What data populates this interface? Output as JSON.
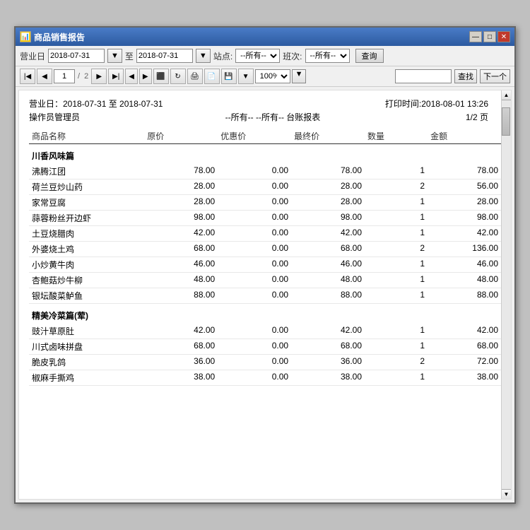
{
  "window": {
    "title": "商品销售报告",
    "title_icon": "📊"
  },
  "titleButtons": {
    "minimize": "—",
    "restore": "□",
    "close": "✕"
  },
  "toolbar": {
    "date_label": "营业日",
    "date_from": "2018-07-31",
    "date_to_sep": "至",
    "date_to": "2018-07-31",
    "station_label": "站点:",
    "station_value": "--所有--",
    "shift_label": "班次:",
    "shift_value": "--所有--",
    "query_btn": "查询"
  },
  "navBar": {
    "page_current": "1",
    "page_total": "2",
    "zoom_value": "100%",
    "find_btn": "查找",
    "next_btn": "下一个"
  },
  "report": {
    "date_range": "营业日：2018-07-31 至 2018-07-31",
    "print_time": "打印时间:2018-08-01 13:26",
    "operator": "操作员管理员",
    "center_info": "--所有--  --所有--  台账报表",
    "page_info": "1/2 页",
    "columns": {
      "name": "商品名称",
      "price": "原价",
      "discount": "优惠价",
      "final": "最终价",
      "qty": "数量",
      "amount": "金额"
    },
    "categories": [
      {
        "name": "川香风味篇",
        "items": [
          {
            "name": "沸腾江团",
            "price": "78.00",
            "discount": "0.00",
            "final": "78.00",
            "qty": "1",
            "amount": "78.00"
          },
          {
            "name": "荷兰豆炒山药",
            "price": "28.00",
            "discount": "0.00",
            "final": "28.00",
            "qty": "2",
            "amount": "56.00"
          },
          {
            "name": "家常豆腐",
            "price": "28.00",
            "discount": "0.00",
            "final": "28.00",
            "qty": "1",
            "amount": "28.00"
          },
          {
            "name": "蒜蓉粉丝开边虾",
            "price": "98.00",
            "discount": "0.00",
            "final": "98.00",
            "qty": "1",
            "amount": "98.00"
          },
          {
            "name": "土豆烧腊肉",
            "price": "42.00",
            "discount": "0.00",
            "final": "42.00",
            "qty": "1",
            "amount": "42.00"
          },
          {
            "name": "外婆烧土鸡",
            "price": "68.00",
            "discount": "0.00",
            "final": "68.00",
            "qty": "2",
            "amount": "136.00"
          },
          {
            "name": "小炒黄牛肉",
            "price": "46.00",
            "discount": "0.00",
            "final": "46.00",
            "qty": "1",
            "amount": "46.00"
          },
          {
            "name": "杏鲍菇炒牛柳",
            "price": "48.00",
            "discount": "0.00",
            "final": "48.00",
            "qty": "1",
            "amount": "48.00"
          },
          {
            "name": "银坛酸菜鲈鱼",
            "price": "88.00",
            "discount": "0.00",
            "final": "88.00",
            "qty": "1",
            "amount": "88.00"
          }
        ]
      },
      {
        "name": "精美冷菜篇(荤)",
        "items": [
          {
            "name": "豉汁草原肚",
            "price": "42.00",
            "discount": "0.00",
            "final": "42.00",
            "qty": "1",
            "amount": "42.00"
          },
          {
            "name": "川式卤味拼盘",
            "price": "68.00",
            "discount": "0.00",
            "final": "68.00",
            "qty": "1",
            "amount": "68.00"
          },
          {
            "name": "脆皮乳鸽",
            "price": "36.00",
            "discount": "0.00",
            "final": "36.00",
            "qty": "2",
            "amount": "72.00"
          },
          {
            "name": "椒麻手撕鸡",
            "price": "38.00",
            "discount": "0.00",
            "final": "38.00",
            "qty": "1",
            "amount": "38.00"
          }
        ]
      }
    ]
  }
}
